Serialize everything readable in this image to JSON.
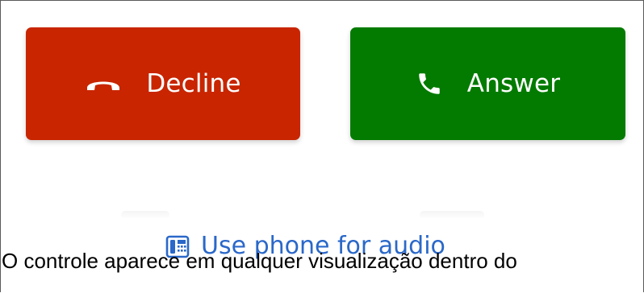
{
  "call_controls": {
    "decline": {
      "label": "Decline",
      "icon": "hang-up-phone-icon",
      "color": "#c82500"
    },
    "answer": {
      "label": "Answer",
      "icon": "phone-handset-icon",
      "color": "#037b00"
    }
  },
  "phone_audio": {
    "label": "Use phone for audio",
    "icon": "desk-phone-icon",
    "color": "#2a68c9"
  },
  "caption": {
    "text": "O controle aparece em qualquer visualização dentro do"
  }
}
